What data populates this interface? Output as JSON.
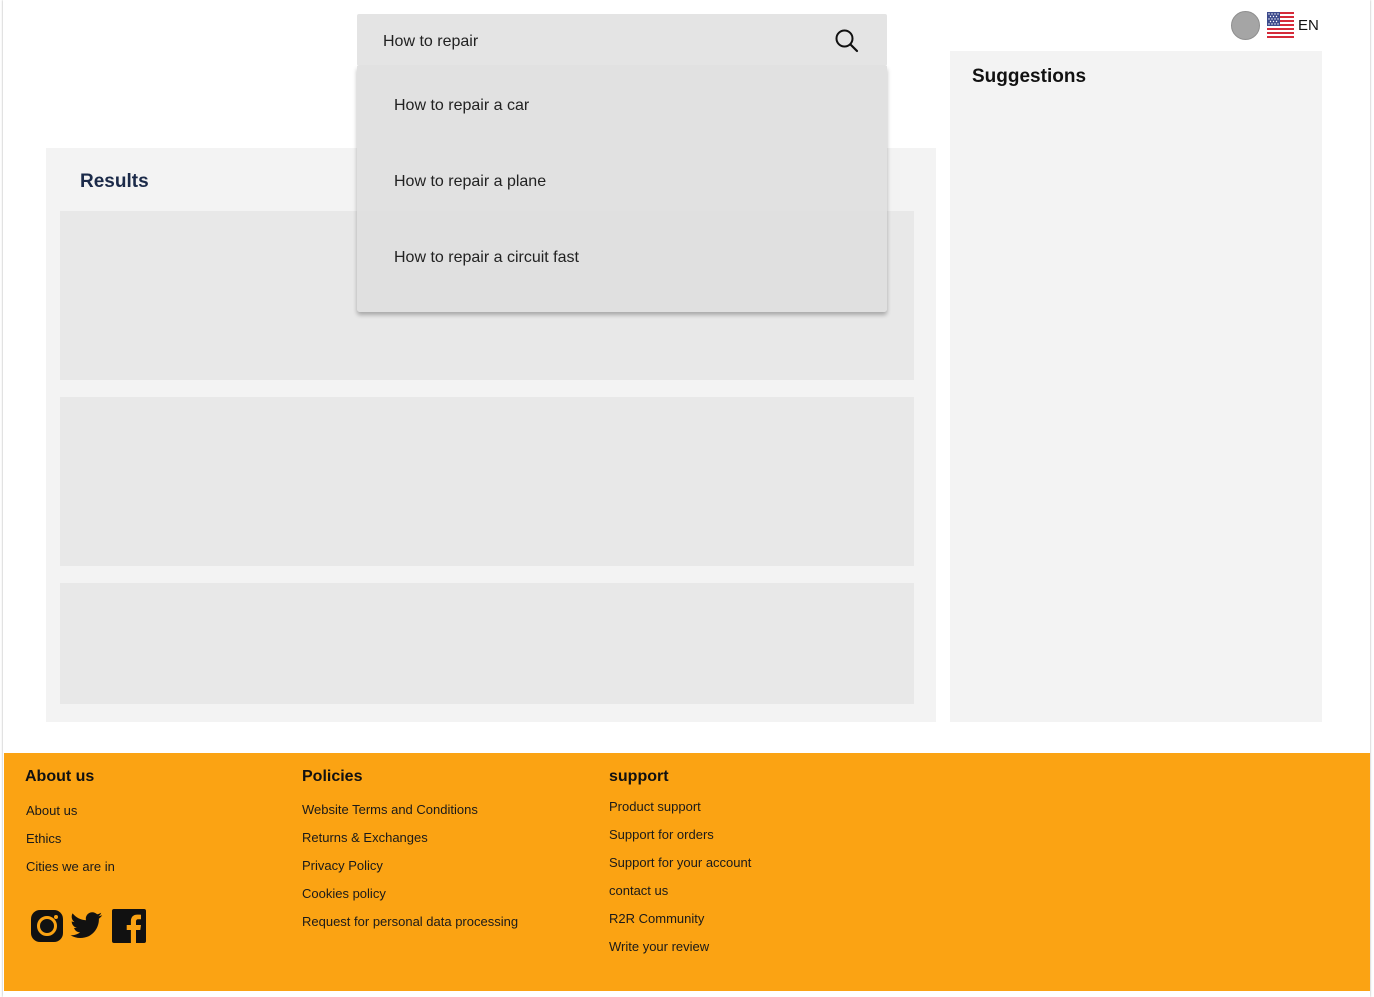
{
  "search": {
    "value": "How to repair",
    "suggestions": [
      "How to repair a car",
      "How to repair a plane",
      "How to repair a circuit fast"
    ]
  },
  "header": {
    "language": "EN"
  },
  "results": {
    "title": "Results"
  },
  "suggestions_panel": {
    "title": "Suggestions"
  },
  "footer": {
    "about": {
      "heading": "About us",
      "links": [
        "About us",
        "Ethics",
        "Cities we are in"
      ]
    },
    "policies": {
      "heading": "Policies",
      "links": [
        "Website Terms and Conditions",
        "Returns & Exchanges",
        "Privacy Policy",
        "Cookies policy",
        "Request for personal data processing"
      ]
    },
    "support": {
      "heading": "support",
      "links": [
        "Product support",
        "Support for orders",
        "Support for your account",
        "contact us",
        "R2R Community",
        "Write your review"
      ]
    },
    "social_icons": [
      "instagram-icon",
      "twitter-icon",
      "facebook-icon"
    ]
  },
  "colors": {
    "footer_background": "#fba313",
    "panel_background": "#f3f3f3",
    "card_background": "#e8e8e8",
    "results_title": "#1b2a49"
  }
}
